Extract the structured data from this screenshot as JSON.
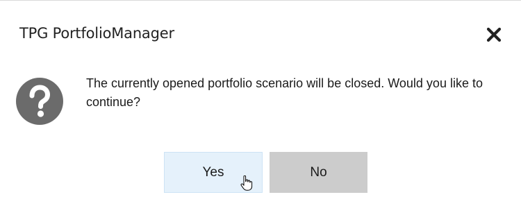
{
  "dialog": {
    "title": "TPG PortfolioManager",
    "message": "The currently opened portfolio scenario will be closed. Would you like to continue?",
    "icon": "question-icon",
    "close_icon": "close-icon"
  },
  "buttons": {
    "yes_label": "Yes",
    "no_label": "No"
  },
  "colors": {
    "yes_bg": "#e5f1fb",
    "no_bg": "#cccccc",
    "icon_fill": "#6b6b6b"
  }
}
